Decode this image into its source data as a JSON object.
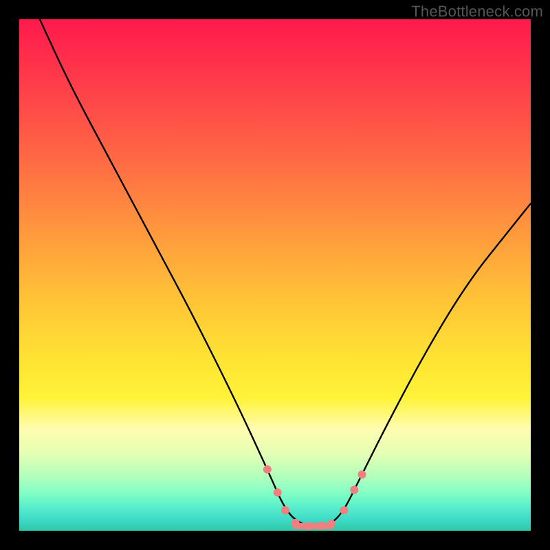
{
  "watermark": "TheBottleneck.com",
  "chart_data": {
    "type": "line",
    "title": "",
    "xlabel": "",
    "ylabel": "",
    "xlim": [
      0,
      100
    ],
    "ylim": [
      0,
      100
    ],
    "grid": false,
    "legend": false,
    "series": [
      {
        "name": "curve",
        "color": "#000000",
        "x": [
          4,
          10,
          18,
          26,
          34,
          42,
          48.5,
          52,
          55,
          58,
          61,
          63.5,
          66,
          72,
          80,
          88,
          96,
          100
        ],
        "y": [
          100,
          87,
          72,
          57,
          42,
          26,
          12,
          4,
          1.3,
          0.8,
          1.3,
          4,
          9,
          21,
          36,
          49,
          59,
          64
        ]
      }
    ],
    "markers": {
      "name": "highlight-points",
      "color": "#f08080",
      "radius": 6,
      "points": [
        {
          "x": 48.5,
          "y": 12
        },
        {
          "x": 50.5,
          "y": 7.5
        },
        {
          "x": 52.0,
          "y": 4.0
        },
        {
          "x": 54.0,
          "y": 1.5
        },
        {
          "x": 56.5,
          "y": 0.9
        },
        {
          "x": 59.0,
          "y": 1.0
        },
        {
          "x": 61.0,
          "y": 1.4
        },
        {
          "x": 63.5,
          "y": 4.0
        },
        {
          "x": 65.5,
          "y": 8.0
        },
        {
          "x": 67.0,
          "y": 11.0
        }
      ]
    },
    "bottom_band": {
      "name": "flat-min-band",
      "color": "#f08080",
      "y": 0.9,
      "x_start": 54,
      "x_end": 61,
      "thickness": 9
    }
  }
}
